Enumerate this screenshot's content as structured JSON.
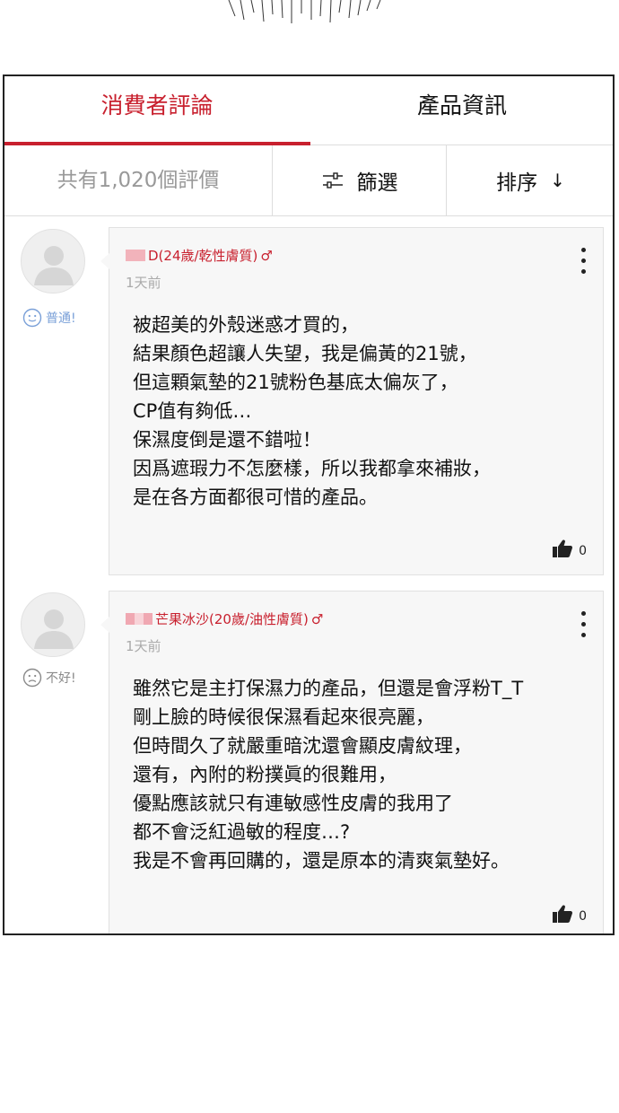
{
  "tabs": [
    {
      "label": "消費者評論",
      "active": true
    },
    {
      "label": "產品資訊",
      "active": false
    }
  ],
  "toolbar": {
    "total": "共有1,020個評價",
    "filter_label": "篩選",
    "sort_label": "排序",
    "sort_arrow": "↓"
  },
  "reviews": [
    {
      "user": "D(24歲/乾性膚質)",
      "gender": "♂",
      "time": "1天前",
      "rating_label": "普通!",
      "rating_icon": "neutral-face-icon",
      "lines": [
        "被超美的外殼迷惑才買的，",
        "結果顏色超讓人失望，我是偏黃的21號，",
        "但這顆氣墊的21號粉色基底太偏灰了，",
        "CP值有夠低…",
        "保濕度倒是還不錯啦！",
        "因爲遮瑕力不怎麼樣，所以我都拿來補妝，",
        "是在各方面都很可惜的產品。"
      ],
      "likes": "0"
    },
    {
      "user": "芒果冰沙(20歲/油性膚質)",
      "gender": "♂",
      "time": "1天前",
      "rating_label": "不好!",
      "rating_icon": "sad-face-icon",
      "lines": [
        "雖然它是主打保濕力的產品，但還是會浮粉T_T",
        "剛上臉的時候很保濕看起來很亮麗，",
        "但時間久了就嚴重暗沈還會顯皮膚紋理，",
        "還有，內附的粉撲眞的很難用，",
        "優點應該就只有連敏感性皮膚的我用了",
        "都不會泛紅過敏的程度…?",
        "我是不會再回購的，還是原本的清爽氣墊好。"
      ],
      "likes": "0"
    }
  ],
  "colors": {
    "accent": "#c8202e",
    "muted": "#999999",
    "card_bg": "#f7f7f7"
  }
}
